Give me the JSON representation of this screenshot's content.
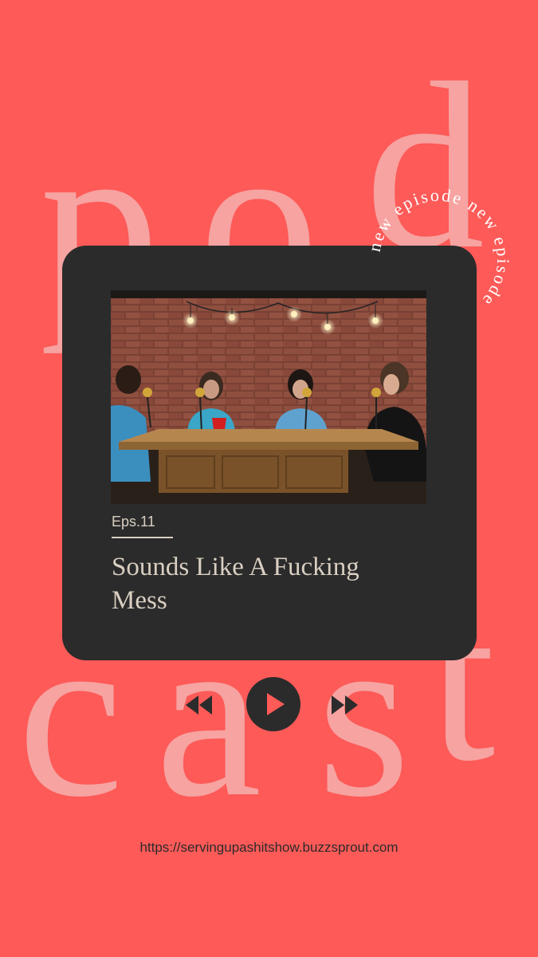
{
  "background": {
    "color": "#fd5a58",
    "word_top": "pod",
    "word_bottom": "cast",
    "letter_color": "#f6a3a1"
  },
  "badge": {
    "ring_text": "new episode new episode "
  },
  "card": {
    "background": "#2b2b2b",
    "episode_label": "Eps.11",
    "title": "Sounds Like A Fucking Mess",
    "text_color": "#d9cfc2"
  },
  "player": {
    "rewind_icon": "rewind-icon",
    "play_icon": "play-icon",
    "forward_icon": "fast-forward-icon"
  },
  "footer": {
    "url": "https://servingupashitshow.buzzsprout.com"
  }
}
